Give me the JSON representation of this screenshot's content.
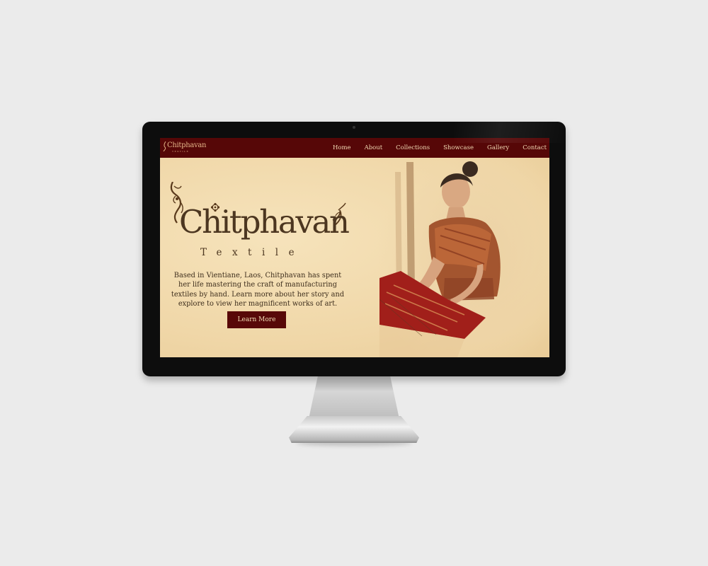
{
  "nav": {
    "logo_text": "Chitphavan",
    "logo_sub": "TEXTILE",
    "links": [
      "Home",
      "About",
      "Collections",
      "Showcase",
      "Gallery",
      "Contact"
    ]
  },
  "hero": {
    "brand_name": "Chitphavan",
    "brand_sub": "Textile",
    "description": "Based in Vientiane, Laos, Chitphavan has spent her life mastering the craft of manufacturing textiles by hand. Learn more about her story and explore to view her magnificent works of art.",
    "button_label": "Learn More"
  },
  "colors": {
    "nav_bg": "#560707",
    "hero_bg": "#f3ddb0",
    "button_bg": "#580808",
    "brand_text": "#4c3620"
  },
  "icons": [
    "naga-flourish-icon",
    "flower-icon",
    "weaver-painting"
  ]
}
